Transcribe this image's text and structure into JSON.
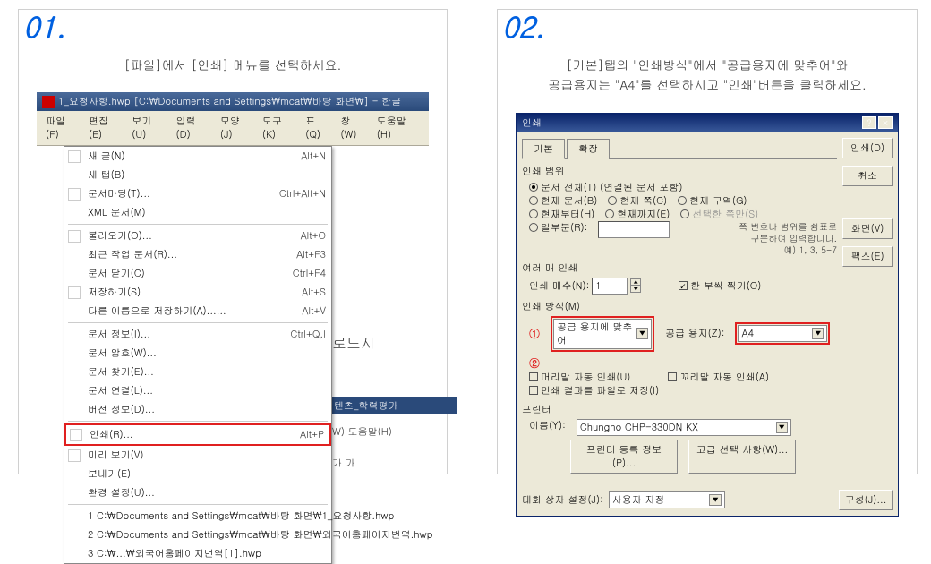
{
  "step1": {
    "num": "01.",
    "instruction": "[파일]에서 [인쇄] 메뉴를 선택하세요.",
    "titlebar": "1_요청사항.hwp [C:\\Documents and Settings\\mcat\\바탕 화면\\] - 한글",
    "menubar": [
      "파일(F)",
      "편집(E)",
      "보기(U)",
      "입력(D)",
      "모양(J)",
      "도구(K)",
      "표(Q)",
      "창(W)",
      "도움말(H)"
    ],
    "menu": {
      "new_doc": "새 글(N)",
      "new_doc_sc": "Alt+N",
      "new_tab": "새 탭(B)",
      "doc_wizard": "문서마당(T)...",
      "doc_wizard_sc": "Ctrl+Alt+N",
      "xml": "XML 문서(M)",
      "open": "불러오기(O)...",
      "open_sc": "Alt+O",
      "recent": "최근 작업 문서(R)...",
      "recent_sc": "Alt+F3",
      "close": "문서 닫기(C)",
      "close_sc": "Ctrl+F4",
      "save": "저장하기(S)",
      "save_sc": "Alt+S",
      "save_as": "다른 이름으로 저장하기(A)......",
      "save_as_sc": "Alt+V",
      "doc_info": "문서 정보(I)...",
      "doc_info_sc": "Ctrl+Q,I",
      "doc_crypt": "문서 암호(W)...",
      "doc_find": "문서 찾기(E)...",
      "doc_link": "문서 연결(L)...",
      "ver_info": "버전 정보(D)...",
      "print": "인쇄(R)...",
      "print_sc": "Alt+P",
      "preview": "미리 보기(V)",
      "send": "보내기(E)",
      "env": "환경 설정(U)...",
      "recent1": "1 C:\\Documents and Settings\\mcat\\바탕 화면\\1_요청사항.hwp",
      "recent2": "2 C:\\Documents and Settings\\mcat\\바탕 화면\\외국어홈페이지번역.hwp",
      "recent3": "3 C:\\...\\외국어홈페이지번역[1].hwp"
    },
    "bg": {
      "frag1": "로드시",
      "frag2": "텐츠_학력평가",
      "frag3": "W) 도움말(H)",
      "frag4": "가 가"
    }
  },
  "step2": {
    "num": "02.",
    "instruction_l1": "[기본]탭의 \"인쇄방식\"에서 \"공급용지에 맞추어\"와",
    "instruction_l2": "공급용지는 \"A4\"를 선택하시고 \"인쇄\"버튼을 클릭하세요.",
    "dlg_title": "인쇄",
    "buttons": {
      "print": "인쇄(D)",
      "cancel": "취소",
      "screen": "화면(V)",
      "fax": "팩스(E)"
    },
    "tabs": {
      "basic": "기본",
      "ext": "확장"
    },
    "range": {
      "title": "인쇄 범위",
      "all": "문서 전체(T) (연결된 문서 포함)",
      "cur_doc": "현재 문서(B)",
      "cur_sec": "현재 쪽(C)",
      "cur_area": "현재 구역(G)",
      "cur_from": "현재부터(H)",
      "cur_to": "현재까지(E)",
      "sel_only": "선택한 쪽만(S)",
      "partial": "일부분(R):",
      "hint": "쪽 번호나 범위를 쉼표로\n구분하여 입력합니다.\n예) 1, 3, 5-7"
    },
    "copies": {
      "title": "여러 매 인쇄",
      "count_lbl": "인쇄 매수(N):",
      "count_val": "1",
      "collate": "한 부씩 찍기(O)"
    },
    "method": {
      "title": "인쇄 방식(M)",
      "fit_paper": "공급 용지에 맞추어",
      "paper_lbl": "공급 용지(Z):",
      "paper_val": "A4",
      "hdr_auto": "머리말 자동 인쇄(U)",
      "ftr_auto": "꼬리말 자동 인쇄(A)",
      "to_file": "인쇄 결과를 파일로 저장(I)",
      "marker1": "①",
      "marker2": "②"
    },
    "printer": {
      "title": "프린터",
      "name_lbl": "이름(Y):",
      "name_val": "Chungho CHP-330DN KX",
      "reg": "프린터 등록 정보(P)...",
      "adv": "고급 선택 사항(W)..."
    },
    "dialog_set": {
      "label": "대화 상자 설정(J):",
      "value": "사용자 지정",
      "config": "구성(J)..."
    }
  }
}
